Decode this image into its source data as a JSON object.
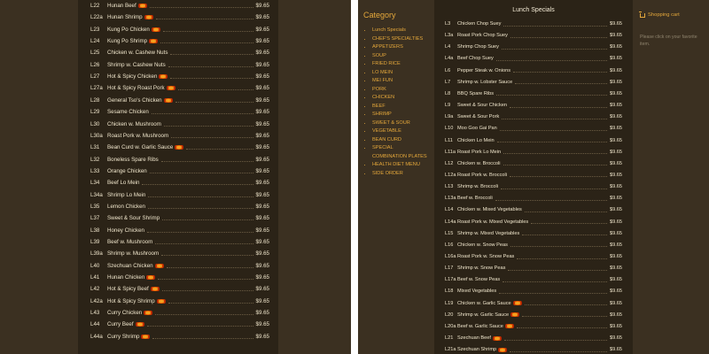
{
  "left_items": [
    {
      "code": "L22",
      "name": "Hunan Beef",
      "hot": true,
      "price": "$9.65"
    },
    {
      "code": "L22a",
      "name": "Hunan Shrimp",
      "hot": true,
      "price": "$9.65"
    },
    {
      "code": "L23",
      "name": "Kung Po Chicken",
      "hot": true,
      "price": "$9.65"
    },
    {
      "code": "L24",
      "name": "Kung Po Shrimp",
      "hot": true,
      "price": "$9.65"
    },
    {
      "code": "L25",
      "name": "Chicken w. Cashew Nuts",
      "hot": false,
      "price": "$9.65"
    },
    {
      "code": "L26",
      "name": "Shrimp w. Cashew Nuts",
      "hot": false,
      "price": "$9.65"
    },
    {
      "code": "L27",
      "name": "Hot & Spicy Chicken",
      "hot": true,
      "price": "$9.65"
    },
    {
      "code": "L27a",
      "name": "Hot & Spicy Roast Pork",
      "hot": true,
      "price": "$9.65"
    },
    {
      "code": "L28",
      "name": "General Tso's Chicken",
      "hot": true,
      "price": "$9.65"
    },
    {
      "code": "L29",
      "name": "Sesame Chicken",
      "hot": false,
      "price": "$9.65"
    },
    {
      "code": "L30",
      "name": "Chicken w. Mushroom",
      "hot": false,
      "price": "$9.65"
    },
    {
      "code": "L30a",
      "name": "Roast Pork w. Mushroom",
      "hot": false,
      "price": "$9.65"
    },
    {
      "code": "L31",
      "name": "Bean Curd w. Garlic Sauce",
      "hot": true,
      "price": "$9.65"
    },
    {
      "code": "L32",
      "name": "Boneless Spare Ribs",
      "hot": false,
      "price": "$9.65"
    },
    {
      "code": "L33",
      "name": "Orange Chicken",
      "hot": false,
      "price": "$9.65"
    },
    {
      "code": "L34",
      "name": "Beef Lo Mein",
      "hot": false,
      "price": "$9.65"
    },
    {
      "code": "L34a",
      "name": "Shrimp Lo Mein",
      "hot": false,
      "price": "$9.65"
    },
    {
      "code": "L35",
      "name": "Lemon Chicken",
      "hot": false,
      "price": "$9.65"
    },
    {
      "code": "L37",
      "name": "Sweet & Sour Shrimp",
      "hot": false,
      "price": "$9.65"
    },
    {
      "code": "L38",
      "name": "Honey Chicken",
      "hot": false,
      "price": "$9.65"
    },
    {
      "code": "L39",
      "name": "Beef w. Mushroom",
      "hot": false,
      "price": "$9.65"
    },
    {
      "code": "L39a",
      "name": "Shrimp w. Mushroom",
      "hot": false,
      "price": "$9.65"
    },
    {
      "code": "L40",
      "name": "Szechuan Chicken",
      "hot": true,
      "price": "$9.65"
    },
    {
      "code": "L41",
      "name": "Hunan Chicken",
      "hot": true,
      "price": "$9.65"
    },
    {
      "code": "L42",
      "name": "Hot & Spicy Beef",
      "hot": true,
      "price": "$9.65"
    },
    {
      "code": "L42a",
      "name": "Hot & Spicy Shrimp",
      "hot": true,
      "price": "$9.65"
    },
    {
      "code": "L43",
      "name": "Curry Chicken",
      "hot": true,
      "price": "$9.65"
    },
    {
      "code": "L44",
      "name": "Curry Beef",
      "hot": true,
      "price": "$9.65"
    },
    {
      "code": "L44a",
      "name": "Curry Shrimp",
      "hot": true,
      "price": "$9.65"
    }
  ],
  "category": {
    "title": "Category",
    "items": [
      "Lunch Specials",
      "CHEF'S SPECIALTIES",
      "APPETIZERS",
      "SOUP",
      "FRIED RICE",
      "LO MEIN",
      "MEI FUN",
      "PORK",
      "CHICKEN",
      "BEEF",
      "SHRIMP",
      "SWEET & SOUR",
      "VEGETABLE",
      "BEAN CURD",
      "SPECIAL COMBINATION PLATES",
      "HEALTH DIET MENU",
      "SIDE ORDER"
    ]
  },
  "section": {
    "title": "Lunch Specials"
  },
  "right_items": [
    {
      "code": "L3",
      "name": "Chicken Chop Suey",
      "hot": false,
      "price": "$9.65"
    },
    {
      "code": "L3a",
      "name": "Roast Pork Chop Suey",
      "hot": false,
      "price": "$9.65"
    },
    {
      "code": "L4",
      "name": "Shrimp Chop Suey",
      "hot": false,
      "price": "$9.65"
    },
    {
      "code": "L4a",
      "name": "Beef Chop Suey",
      "hot": false,
      "price": "$9.65"
    },
    {
      "code": "L6",
      "name": "Pepper Steak w. Onions",
      "hot": false,
      "price": "$9.65"
    },
    {
      "code": "L7",
      "name": "Shrimp w. Lobster Sauce",
      "hot": false,
      "price": "$9.65"
    },
    {
      "code": "L8",
      "name": "BBQ Spare Ribs",
      "hot": false,
      "price": "$9.65"
    },
    {
      "code": "L9",
      "name": "Sweet & Sour Chicken",
      "hot": false,
      "price": "$9.65"
    },
    {
      "code": "L9a",
      "name": "Sweet & Sour Pork",
      "hot": false,
      "price": "$9.65"
    },
    {
      "code": "L10",
      "name": "Moo Goo Gai Pan",
      "hot": false,
      "price": "$9.65"
    },
    {
      "code": "L11",
      "name": "Chicken Lo Mein",
      "hot": false,
      "price": "$9.65"
    },
    {
      "code": "L11a",
      "name": "Roast Pork Lo Mein",
      "hot": false,
      "price": "$9.65"
    },
    {
      "code": "L12",
      "name": "Chicken w. Broccoli",
      "hot": false,
      "price": "$9.65"
    },
    {
      "code": "L12a",
      "name": "Roast Pork w. Broccoli",
      "hot": false,
      "price": "$9.65"
    },
    {
      "code": "L13",
      "name": "Shrimp w. Broccoli",
      "hot": false,
      "price": "$9.65"
    },
    {
      "code": "L13a",
      "name": "Beef w. Broccoli",
      "hot": false,
      "price": "$9.65"
    },
    {
      "code": "L14",
      "name": "Chicken w. Mixed Vegetables",
      "hot": false,
      "price": "$9.65"
    },
    {
      "code": "L14a",
      "name": "Roast Pork w. Mixed Vegetables",
      "hot": false,
      "price": "$9.65"
    },
    {
      "code": "L15",
      "name": "Shrimp w. Mixed Vegetables",
      "hot": false,
      "price": "$9.65"
    },
    {
      "code": "L16",
      "name": "Chicken w. Snow Peas",
      "hot": false,
      "price": "$9.65"
    },
    {
      "code": "L16a",
      "name": "Roast Pork w. Snow Peas",
      "hot": false,
      "price": "$9.65"
    },
    {
      "code": "L17",
      "name": "Shrimp w. Snow Peas",
      "hot": false,
      "price": "$9.65"
    },
    {
      "code": "L17a",
      "name": "Beef w. Snow Peas",
      "hot": false,
      "price": "$9.65"
    },
    {
      "code": "L18",
      "name": "Mixed Vegetables",
      "hot": false,
      "price": "$9.65"
    },
    {
      "code": "L19",
      "name": "Chicken w. Garlic Sauce",
      "hot": true,
      "price": "$9.65"
    },
    {
      "code": "L20",
      "name": "Shrimp w. Garlic Sauce",
      "hot": true,
      "price": "$9.65"
    },
    {
      "code": "L20a",
      "name": "Beef w. Garlic Sauce",
      "hot": true,
      "price": "$9.65"
    },
    {
      "code": "L21",
      "name": "Szechuan Beef",
      "hot": true,
      "price": "$9.65"
    },
    {
      "code": "L21a",
      "name": "Szechuan Shrimp",
      "hot": true,
      "price": "$9.65"
    }
  ],
  "cart": {
    "title": "Shopping cart",
    "message": "Please click on your favorite item."
  },
  "colors": {
    "accent": "#e5a83b",
    "menu_bg": "#2b2317",
    "side_bg": "#3b3021",
    "hot_badge": "#f06a00"
  },
  "icons": {
    "hot": "hot-spicy-icon",
    "cart": "shopping-cart-icon"
  }
}
